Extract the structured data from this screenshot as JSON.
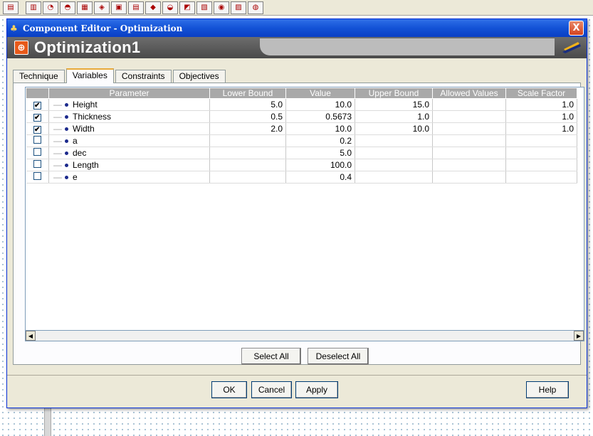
{
  "window": {
    "title": "Component Editor - Optimization",
    "close_label": "X"
  },
  "header": {
    "component_name": "Optimization1"
  },
  "tabs": [
    {
      "label": "Technique"
    },
    {
      "label": "Variables"
    },
    {
      "label": "Constraints"
    },
    {
      "label": "Objectives"
    }
  ],
  "table": {
    "columns": [
      "",
      "Parameter",
      "Lower Bound",
      "Value",
      "Upper Bound",
      "Allowed Values",
      "Scale Factor"
    ],
    "rows": [
      {
        "checked": true,
        "check_mark": "✔",
        "name": "Height",
        "lower": "5.0",
        "value": "10.0",
        "upper": "15.0",
        "allowed": "",
        "scale": "1.0"
      },
      {
        "checked": true,
        "check_mark": "✔",
        "name": "Thickness",
        "lower": "0.5",
        "value": "0.5673",
        "upper": "1.0",
        "allowed": "",
        "scale": "1.0"
      },
      {
        "checked": true,
        "check_mark": "✔",
        "name": "Width",
        "lower": "2.0",
        "value": "10.0",
        "upper": "10.0",
        "allowed": "",
        "scale": "1.0"
      },
      {
        "checked": false,
        "check_mark": "",
        "name": "a",
        "lower": "",
        "value": "0.2",
        "upper": "",
        "allowed": "",
        "scale": ""
      },
      {
        "checked": false,
        "check_mark": "",
        "name": "dec",
        "lower": "",
        "value": "5.0",
        "upper": "",
        "allowed": "",
        "scale": ""
      },
      {
        "checked": false,
        "check_mark": "",
        "name": "Length",
        "lower": "",
        "value": "100.0",
        "upper": "",
        "allowed": "",
        "scale": ""
      },
      {
        "checked": false,
        "check_mark": "",
        "name": "e",
        "lower": "",
        "value": "0.4",
        "upper": "",
        "allowed": "",
        "scale": ""
      }
    ]
  },
  "selection_buttons": {
    "select_all": "Select All",
    "deselect_all": "Deselect All"
  },
  "footer_buttons": {
    "ok": "OK",
    "cancel": "Cancel",
    "apply": "Apply",
    "help": "Help"
  },
  "scroll": {
    "left_arrow": "◀",
    "right_arrow": "▶"
  },
  "icons": {
    "app": "component-editor-icon",
    "component": "optimization-icon",
    "logo": "brand-swoosh-icon"
  },
  "colors": {
    "titlebar": "#1352d6",
    "header_band": "#4a4a4a",
    "column_header": "#a9a9a9",
    "tab_highlight": "#e8a93a",
    "bullet": "#1c2a8c"
  }
}
